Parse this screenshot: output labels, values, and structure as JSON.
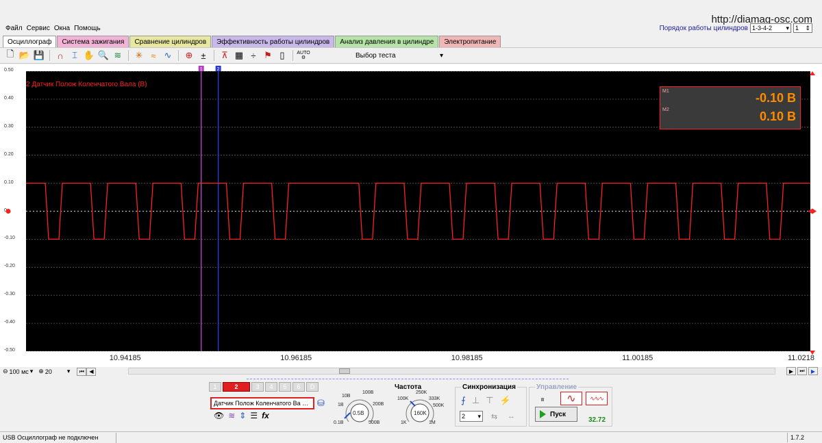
{
  "site_url": "http://diamag-osc.com",
  "menu": [
    "Файл",
    "Сервис",
    "Окна",
    "Помощь"
  ],
  "cyl_order": {
    "label": "Порядок работы цилиндров",
    "value": "1-3-4-2",
    "count": "1"
  },
  "tabs": [
    {
      "label": "Осциллограф",
      "color": "#ffffff"
    },
    {
      "label": "Система зажигания",
      "color": "#f2b3d6"
    },
    {
      "label": "Сравнение цилиндров",
      "color": "#e7e7a0"
    },
    {
      "label": "Эффективность работы цилиндров",
      "color": "#c9b9ea"
    },
    {
      "label": "Анализ давления в цилиндре",
      "color": "#b5e3a8"
    },
    {
      "label": "Электропитание",
      "color": "#f1b7b7"
    }
  ],
  "toolbar": {
    "test_select": "Выбор теста",
    "cursor1": "1",
    "cursor2": "2",
    "auto": "AUTO"
  },
  "plot": {
    "channel_title": "2 Датчик Полож Коленчатого Вала (В)",
    "y_ticks": [
      "0.50",
      "0.40",
      "0.30",
      "0.20",
      "0.10",
      "0",
      "-0.10",
      "-0.20",
      "-0.30",
      "-0.40",
      "-0.50"
    ],
    "x_ticks": [
      "10.94185",
      "10.96185",
      "10.98185",
      "11.00185",
      "11.0218"
    ],
    "meas": {
      "m1_label": "M1",
      "m1_value": "-0.10 В",
      "m2_label": "M2",
      "m2_value": "0.10 В"
    },
    "trace_color": "#ff2020"
  },
  "chart_data": {
    "type": "line",
    "title": "2 Датчик Полож Коленчатого Вала (В)",
    "xlabel": "",
    "ylabel": "",
    "ylim": [
      -0.5,
      0.5
    ],
    "xlim": [
      10.93,
      11.0218
    ],
    "x_ticks": [
      10.94185,
      10.96185,
      10.98185,
      11.00185,
      11.0218
    ],
    "high_level": 0.1,
    "low_level": -0.1,
    "low_pulses": [
      [
        10.93225,
        10.93425
      ],
      [
        10.93755,
        10.93955
      ],
      [
        10.94285,
        10.94485
      ],
      [
        10.94815,
        10.95015
      ],
      [
        10.95345,
        10.95545
      ],
      [
        10.95875,
        10.96075
      ],
      [
        10.96895,
        10.97095
      ],
      [
        10.97425,
        10.97625
      ],
      [
        10.97955,
        10.98155
      ],
      [
        10.98485,
        10.98685
      ],
      [
        10.99015,
        10.99215
      ],
      [
        10.99545,
        10.99745
      ],
      [
        11.00075,
        11.00275
      ],
      [
        11.00605,
        11.00805
      ],
      [
        11.01135,
        11.01335
      ],
      [
        11.01665,
        11.01865
      ]
    ],
    "cursors": [
      10.9505,
      10.9525
    ]
  },
  "timebase": {
    "time_div": "100 мс",
    "zoom": "20"
  },
  "channels": {
    "buttons": [
      "1",
      "2",
      "3",
      "4",
      "5",
      "6",
      "D"
    ],
    "active": "2",
    "selected_sensor": "Датчик Полож Коленчатого Ва"
  },
  "voltage_knob": {
    "value": "0.5В",
    "labels": [
      "10В",
      "100В",
      "1В",
      "200В",
      "0.1В",
      "500В"
    ]
  },
  "freq": {
    "title": "Частота",
    "value": "160K",
    "labels": [
      "250K",
      "100K",
      "333K",
      "500K",
      "1K",
      "1M"
    ]
  },
  "sync": {
    "title": "Синхронизация",
    "channel": "2"
  },
  "control": {
    "title": "Управление",
    "start_label": "Пуск",
    "fps": "32.72"
  },
  "status": {
    "message": "USB Осциллограф не подключен",
    "version": "1.7.2"
  }
}
